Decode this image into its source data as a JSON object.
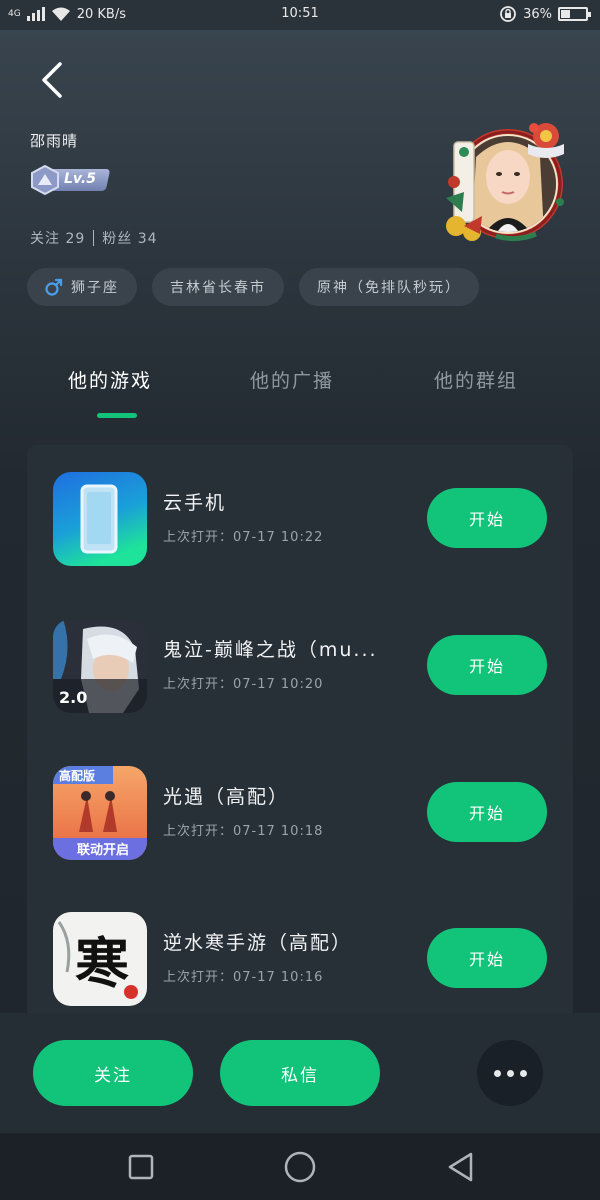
{
  "status_bar": {
    "network": "4G",
    "speed": "20 KB/s",
    "time": "10:51",
    "battery": "36%"
  },
  "profile": {
    "username": "邵雨晴",
    "level": "Lv.5",
    "following": "关注 29",
    "followers": "粉丝 34",
    "tags": [
      "狮子座",
      "吉林省长春市",
      "原神（免排队秒玩）"
    ]
  },
  "tabs": [
    {
      "label": "他的游戏",
      "active": true
    },
    {
      "label": "他的广播",
      "active": false
    },
    {
      "label": "他的群组",
      "active": false
    }
  ],
  "games": [
    {
      "name": "云手机",
      "last_opened": "上次打开：07-17 10:22",
      "button": "开始"
    },
    {
      "name": "鬼泣-巅峰之战（mu...",
      "last_opened": "上次打开：07-17 10:20",
      "button": "开始"
    },
    {
      "name": "光遇（高配）",
      "last_opened": "上次打开：07-17 10:18",
      "button": "开始"
    },
    {
      "name": "逆水寒手游（高配）",
      "last_opened": "上次打开：07-17 10:16",
      "button": "开始"
    }
  ],
  "icon_texts": {
    "devil_may_cry_version": "2.0",
    "sky_top": "高配版",
    "sky_bottom": "联动开启",
    "justice_char": "寒"
  },
  "actions": {
    "follow": "关注",
    "message": "私信"
  },
  "colors": {
    "accent": "#12c47a",
    "background": "#1f262d",
    "card": "#283037"
  }
}
